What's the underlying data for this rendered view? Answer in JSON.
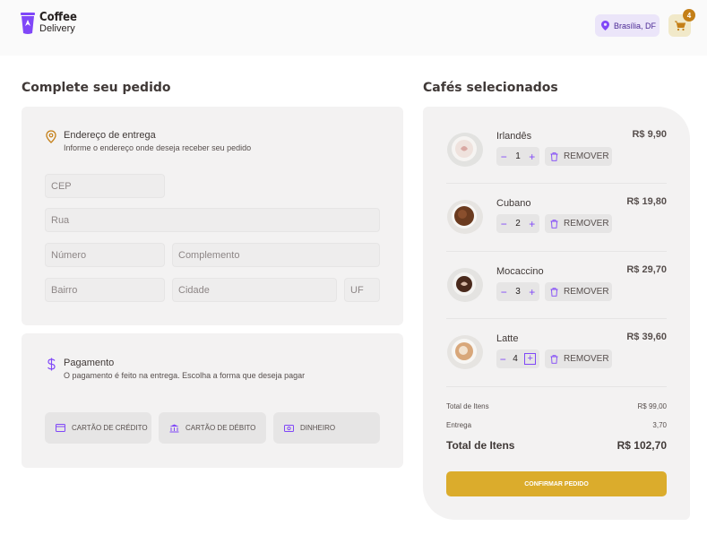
{
  "header": {
    "logo_line1": "Coffee",
    "logo_line2": "Delivery",
    "location": "Brasília, DF",
    "cart_count": "4"
  },
  "colors": {
    "purple": "#8047f8",
    "purple_dark": "#4b2995",
    "yellow": "#dbac2c",
    "yellow_dark": "#c47f17",
    "card_bg": "#f3f2f2"
  },
  "checkout": {
    "title": "Complete seu pedido",
    "address": {
      "heading": "Endereço de entrega",
      "subheading": "Informe o endereço onde deseja receber seu pedido",
      "fields": {
        "cep": "CEP",
        "rua": "Rua",
        "numero": "Número",
        "complemento": "Complemento",
        "bairro": "Bairro",
        "cidade": "Cidade",
        "uf": "UF"
      }
    },
    "payment": {
      "heading": "Pagamento",
      "subheading": "O pagamento é feito na entrega. Escolha a forma que deseja pagar",
      "options": [
        "CARTÃO DE CRÉDITO",
        "CARTÃO DE DÉBITO",
        "DINHEIRO"
      ]
    }
  },
  "cart": {
    "title": "Cafés selecionados",
    "remove_label": "REMOVER",
    "items": [
      {
        "name": "Irlandês",
        "qty": "1",
        "price": "R$ 9,90"
      },
      {
        "name": "Cubano",
        "qty": "2",
        "price": "R$ 19,80"
      },
      {
        "name": "Mocaccino",
        "qty": "3",
        "price": "R$ 29,70"
      },
      {
        "name": "Latte",
        "qty": "4",
        "price": "R$ 39,60"
      }
    ],
    "summary": {
      "items_label": "Total de Itens",
      "items_value": "R$ 99,00",
      "delivery_label": "Entrega",
      "delivery_value": "3,70",
      "total_label": "Total de Itens",
      "total_value": "R$ 102,70"
    },
    "confirm_label": "CONFIRMAR PEDIDO"
  }
}
